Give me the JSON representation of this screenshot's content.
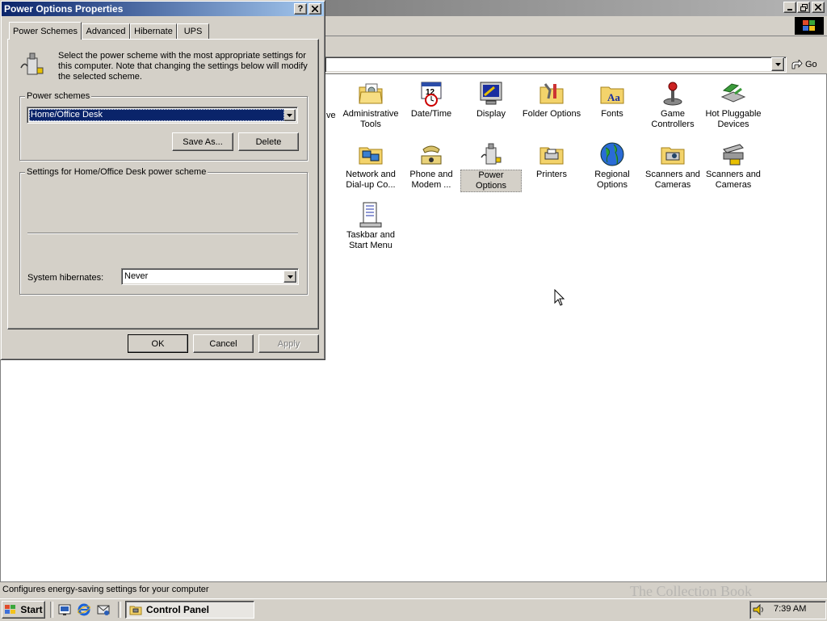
{
  "control_panel": {
    "status": "Configures energy-saving settings for your computer",
    "go_label": "Go",
    "partial_label": "ve",
    "icons": [
      {
        "label": "Administrative Tools",
        "icon": "administrative-tools-icon"
      },
      {
        "label": "Date/Time",
        "icon": "date-time-icon"
      },
      {
        "label": "Display",
        "icon": "display-icon"
      },
      {
        "label": "Folder Options",
        "icon": "folder-options-icon"
      },
      {
        "label": "Fonts",
        "icon": "fonts-icon"
      },
      {
        "label": "Game Controllers",
        "icon": "game-controllers-icon"
      },
      {
        "label": "Hot Pluggable Devices",
        "icon": "hot-pluggable-devices-icon"
      },
      {
        "label": "Network and Dial-up Co...",
        "icon": "network-dialup-icon"
      },
      {
        "label": "Phone and Modem ...",
        "icon": "phone-modem-icon"
      },
      {
        "label": "Power Options",
        "icon": "power-options-icon",
        "selected": true
      },
      {
        "label": "Printers",
        "icon": "printers-icon"
      },
      {
        "label": "Regional Options",
        "icon": "regional-options-icon"
      },
      {
        "label": "Scanners and Cameras",
        "icon": "scanners-cameras-icon"
      },
      {
        "label": "Scanners and Cameras",
        "icon": "scanners-cameras-2-icon"
      },
      {
        "label": "Taskbar and Start Menu",
        "icon": "taskbar-start-menu-icon"
      }
    ]
  },
  "dialog": {
    "title": "Power Options Properties",
    "help_label": "?",
    "close_label": "✕",
    "tabs": [
      {
        "label": "Power Schemes",
        "active": true
      },
      {
        "label": "Advanced"
      },
      {
        "label": "Hibernate"
      },
      {
        "label": "UPS"
      }
    ],
    "intro": "Select the power scheme with the most appropriate settings for this computer. Note that changing the settings below will modify the selected scheme.",
    "schemes_group_label": "Power schemes",
    "selected_scheme": "Home/Office Desk",
    "save_as_label": "Save As...",
    "delete_label": "Delete",
    "settings_group_label": "Settings for Home/Office Desk power scheme",
    "hibernate_label": "System hibernates:",
    "hibernate_value": "Never",
    "ok_label": "OK",
    "cancel_label": "Cancel",
    "apply_label": "Apply"
  },
  "taskbar": {
    "start_label": "Start",
    "task_label": "Control Panel",
    "clock": "7:39 AM"
  },
  "watermark": "The Collection Book"
}
